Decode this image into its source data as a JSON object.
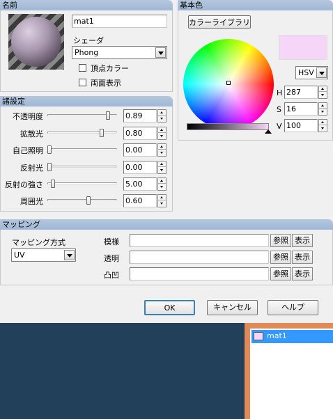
{
  "name_section": {
    "header": "名前",
    "name_value": "mat1",
    "shader_label": "シェーダ",
    "shader_value": "Phong",
    "vertex_color_label": "頂点カラー",
    "double_sided_label": "両面表示"
  },
  "base_color": {
    "header": "基本色",
    "library_button": "カラーライブラリ",
    "mode_value": "HSV",
    "h_label": "H",
    "h_value": "287",
    "s_label": "S",
    "s_value": "16",
    "v_label": "V",
    "v_value": "100",
    "swatch_color": "#f5d6f8"
  },
  "settings": {
    "header": "諸設定",
    "rows": [
      {
        "label": "不透明度",
        "value": "0.89",
        "level": 0.89
      },
      {
        "label": "拡散光",
        "value": "0.80",
        "level": 0.8
      },
      {
        "label": "自己照明",
        "value": "0.00",
        "level": 0.0
      },
      {
        "label": "反射光",
        "value": "0.00",
        "level": 0.0
      },
      {
        "label": "反射の強さ",
        "value": "5.00",
        "level": 0.05
      },
      {
        "label": "周囲光",
        "value": "0.60",
        "level": 0.6
      }
    ]
  },
  "mapping": {
    "header": "マッピング",
    "method_label": "マッピング方式",
    "method_value": "UV",
    "rows": [
      {
        "label": "模様",
        "ref": "参照",
        "show": "表示"
      },
      {
        "label": "透明",
        "ref": "参照",
        "show": "表示"
      },
      {
        "label": "凸凹",
        "ref": "参照",
        "show": "表示"
      }
    ]
  },
  "buttons": {
    "ok": "OK",
    "cancel": "キャンセル",
    "help": "ヘルプ"
  },
  "material_list": {
    "items": [
      {
        "name": "mat1",
        "color": "#f5d6f8"
      }
    ]
  }
}
